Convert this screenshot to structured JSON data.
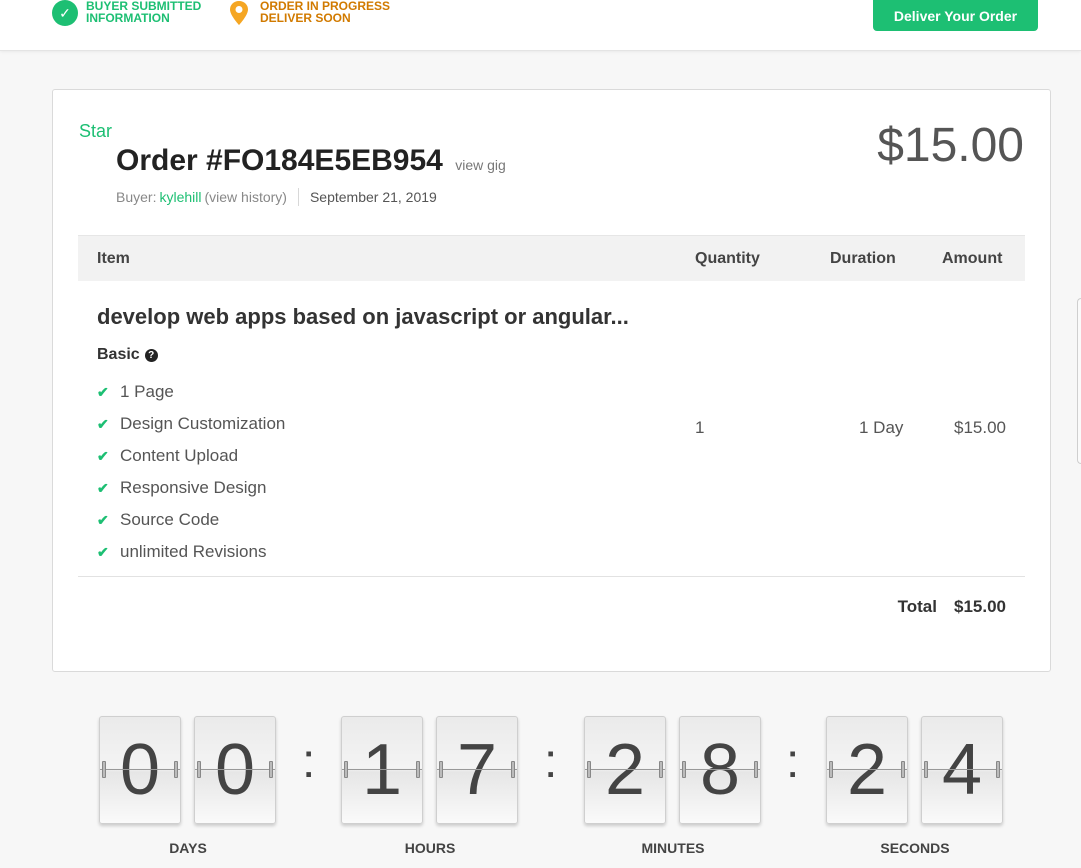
{
  "header": {
    "steps": [
      {
        "line1": "BUYER SUBMITTED",
        "line2": "INFORMATION",
        "icon": "check-circle-icon"
      },
      {
        "line1": "ORDER IN PROGRESS",
        "line2": "DELIVER SOON",
        "icon": "location-pin-icon"
      }
    ],
    "deliver_button": "Deliver Your Order"
  },
  "order": {
    "star_label": "Star",
    "title": "Order #FO184E5EB954",
    "view_gig": "view gig",
    "buyer_label": "Buyer:",
    "buyer_name": "kylehill",
    "view_history": "(view history)",
    "date": "September 21, 2019",
    "price": "$15.00"
  },
  "table": {
    "headers": {
      "item": "Item",
      "quantity": "Quantity",
      "duration": "Duration",
      "amount": "Amount"
    },
    "item_title": "develop web apps based on javascript or angular...",
    "package": "Basic",
    "features": [
      "1 Page",
      "Design Customization",
      "Content Upload",
      "Responsive Design",
      "Source Code",
      "unlimited Revisions"
    ],
    "quantity": "1",
    "duration": "1 Day",
    "amount": "$15.00",
    "total_label": "Total",
    "total_value": "$15.00"
  },
  "countdown": {
    "digits": [
      "0",
      "0",
      "1",
      "7",
      "2",
      "8",
      "2",
      "4"
    ],
    "separator": ":",
    "units": [
      "DAYS",
      "HOURS",
      "MINUTES",
      "SECONDS"
    ]
  },
  "colors": {
    "accent": "#1dbf73",
    "warning": "#d17a00"
  }
}
